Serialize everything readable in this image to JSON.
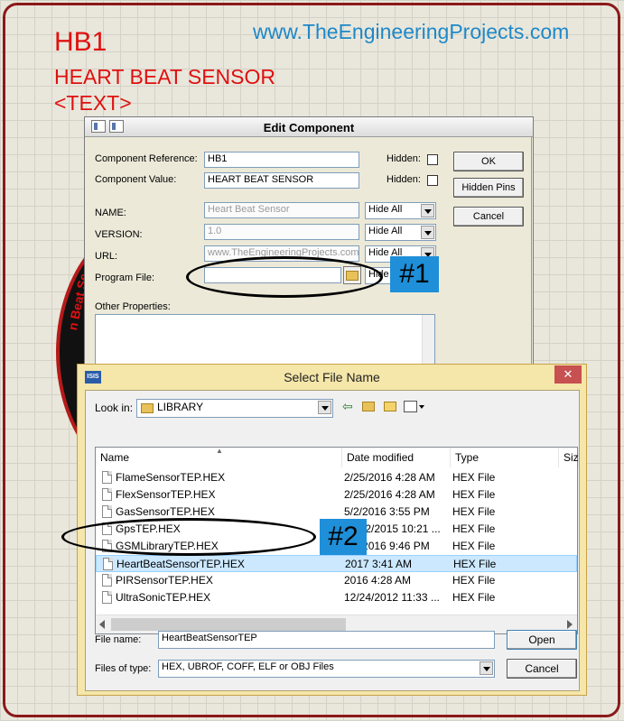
{
  "canvas": {
    "ref_text": "HB1",
    "value_text": "HEART BEAT SENSOR",
    "text_tag": "<TEXT>",
    "website": "www.TheEngineeringProjects.com",
    "disc_text": "n Beat Se"
  },
  "edit_dialog": {
    "title": "Edit Component",
    "component_reference_label": "Component Reference:",
    "component_reference_value": "HB1",
    "component_value_label": "Component Value:",
    "component_value_value": "HEART BEAT SENSOR",
    "hidden_label": "Hidden:",
    "name_label": "NAME:",
    "name_value": "Heart Beat Sensor",
    "version_label": "VERSION:",
    "version_value": "1.0",
    "url_label": "URL:",
    "url_value": "www.TheEngineeringProjects.com",
    "program_file_label": "Program File:",
    "program_file_value": "",
    "hide_all": "Hide All",
    "hide_partial": "Hide",
    "other_properties_label": "Other Properties:",
    "ok_label": "OK",
    "hidden_pins_label": "Hidden Pins",
    "cancel_label": "Cancel"
  },
  "file_dialog": {
    "title": "Select File Name",
    "app_icon": "ISIS",
    "close_label": "✕",
    "look_in_label": "Look in:",
    "look_in_value": "LIBRARY",
    "columns": [
      "Name",
      "Date modified",
      "Type",
      "Size"
    ],
    "files": [
      {
        "name": "FlameSensorTEP.HEX",
        "date": "2/25/2016 4:28 AM",
        "type": "HEX File",
        "selected": false
      },
      {
        "name": "FlexSensorTEP.HEX",
        "date": "2/25/2016 4:28 AM",
        "type": "HEX File",
        "selected": false
      },
      {
        "name": "GasSensorTEP.HEX",
        "date": "5/2/2016 3:55 PM",
        "type": "HEX File",
        "selected": false
      },
      {
        "name": "GpsTEP.HEX",
        "date": "12/22/2015 10:21 ...",
        "type": "HEX File",
        "selected": false
      },
      {
        "name": "GSMLibraryTEP.HEX",
        "date": "4/5/2016 9:46 PM",
        "type": "HEX File",
        "selected": false
      },
      {
        "name": "HeartBeatSensorTEP.HEX",
        "date": "2017 3:41 AM",
        "type": "HEX File",
        "selected": true
      },
      {
        "name": "PIRSensorTEP.HEX",
        "date": "2016 4:28 AM",
        "type": "HEX File",
        "selected": false
      },
      {
        "name": "UltraSonicTEP.HEX",
        "date": "12/24/2012 11:33 ...",
        "type": "HEX File",
        "selected": false
      }
    ],
    "file_name_label": "File name:",
    "file_name_value": "HeartBeatSensorTEP",
    "files_of_type_label": "Files of type:",
    "files_of_type_value": "HEX, UBROF, COFF, ELF or OBJ Files",
    "open_label": "Open",
    "cancel_label": "Cancel"
  },
  "annotations": {
    "tag1": "#1",
    "tag2": "#2"
  },
  "colors": {
    "schematic_text": "#e01010",
    "website_text": "#1e88c8",
    "tag_bg": "#1e8fd8",
    "selection_bg": "#cce8ff",
    "file_dialog_frame": "#f5e6a9"
  }
}
